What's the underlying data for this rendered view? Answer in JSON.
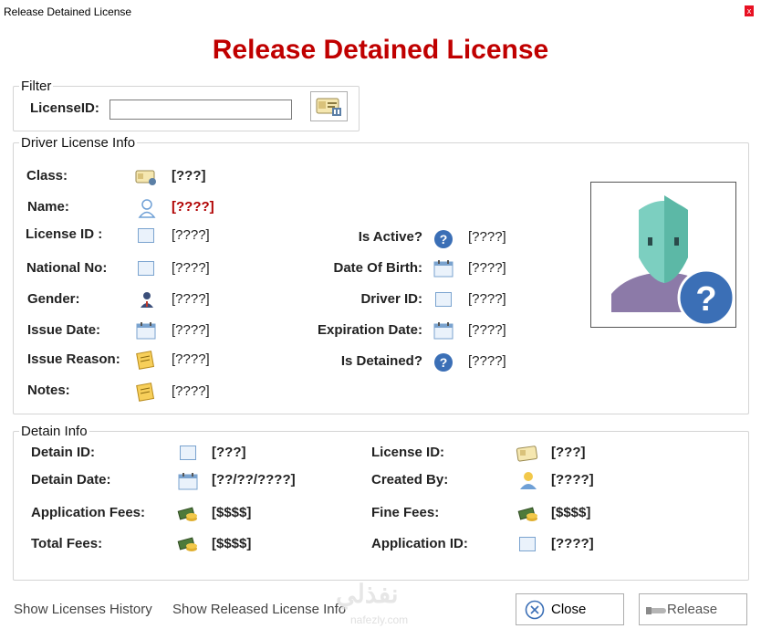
{
  "window": {
    "title": "Release Detained License",
    "close_glyph": "x"
  },
  "heading": "Release Detained License",
  "filter": {
    "group_title": "Filter",
    "license_id_label": "LicenseID:",
    "license_id_value": "",
    "search_icon": "license-search-icon"
  },
  "driver_info": {
    "group_title": "Driver License Info",
    "class": {
      "label": "Class:",
      "value": "[???]"
    },
    "name": {
      "label": "Name:",
      "value": "[????]"
    },
    "license_id": {
      "label": "License ID :",
      "value": "[????]"
    },
    "national_no": {
      "label": "National No:",
      "value": "[????]"
    },
    "gender": {
      "label": "Gender:",
      "value": "[????]"
    },
    "issue_date": {
      "label": "Issue Date:",
      "value": "[????]"
    },
    "issue_reason": {
      "label": "Issue Reason:",
      "value": "[????]"
    },
    "notes": {
      "label": "Notes:",
      "value": "[????]"
    },
    "is_active": {
      "label": "Is Active?",
      "value": "[????]"
    },
    "date_of_birth": {
      "label": "Date Of Birth:",
      "value": "[????]"
    },
    "driver_id": {
      "label": "Driver ID:",
      "value": "[????]"
    },
    "expiration_date": {
      "label": "Expiration Date:",
      "value": "[????]"
    },
    "is_detained": {
      "label": "Is Detained?",
      "value": "[????]"
    }
  },
  "detain_info": {
    "group_title": "Detain Info",
    "detain_id": {
      "label": "Detain ID:",
      "value": "[???]"
    },
    "detain_date": {
      "label": "Detain Date:",
      "value": "[??/??/????]"
    },
    "application_fees": {
      "label": "Application Fees:",
      "value": "[$$$$]"
    },
    "total_fees": {
      "label": "Total Fees:",
      "value": "[$$$$]"
    },
    "license_id": {
      "label": "License ID:",
      "value": "[???]"
    },
    "created_by": {
      "label": "Created By:",
      "value": "[????]"
    },
    "fine_fees": {
      "label": "Fine Fees:",
      "value": "[$$$$]"
    },
    "application_id": {
      "label": "Application ID:",
      "value": "[????]"
    }
  },
  "footer": {
    "show_history": "Show Licenses History",
    "show_released": "Show Released License Info",
    "close_label": "Close",
    "release_label": "Release",
    "watermark_arabic": "نفذلي",
    "watermark_latin": "nafezly.com"
  },
  "colors": {
    "heading": "#c00000",
    "name_value": "#b00000",
    "help_icon": "#3b6fb6"
  }
}
